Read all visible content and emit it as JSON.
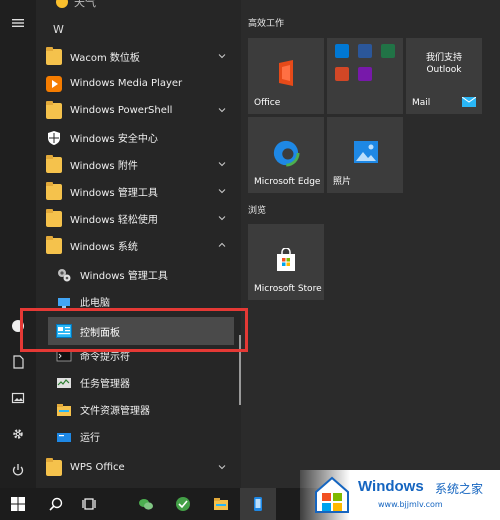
{
  "start_menu": {
    "list": {
      "top_cut_label": "天气",
      "letter_header": "W",
      "items": [
        {
          "label": "Wacom 数位板"
        },
        {
          "label": "Windows Media Player"
        },
        {
          "label": "Windows PowerShell"
        },
        {
          "label": "Windows 安全中心"
        },
        {
          "label": "Windows 附件"
        },
        {
          "label": "Windows 管理工具"
        },
        {
          "label": "Windows 轻松使用"
        },
        {
          "label": "Windows 系统"
        },
        {
          "label": "Windows 管理工具"
        },
        {
          "label": "此电脑"
        },
        {
          "label": "控制面板"
        },
        {
          "label": "命令提示符"
        },
        {
          "label": "任务管理器"
        },
        {
          "label": "文件资源管理器"
        },
        {
          "label": "运行"
        },
        {
          "label": "WPS Office"
        }
      ]
    },
    "tiles": {
      "group1_title": "高效工作",
      "office_label": "Office",
      "outlook_line1": "我们支持",
      "outlook_line2": "Outlook",
      "mail_label": "Mail",
      "edge_label": "Microsoft Edge",
      "photos_label": "照片",
      "group2_title": "浏览",
      "store_label": "Microsoft Store"
    }
  },
  "watermark": {
    "brand": "Windows",
    "brand_cn": "系统之家",
    "url": "www.bjjmlv.com"
  },
  "colors": {
    "accent_red": "#e53935",
    "folder": "#f5c24c",
    "brand_blue": "#1565c0"
  }
}
